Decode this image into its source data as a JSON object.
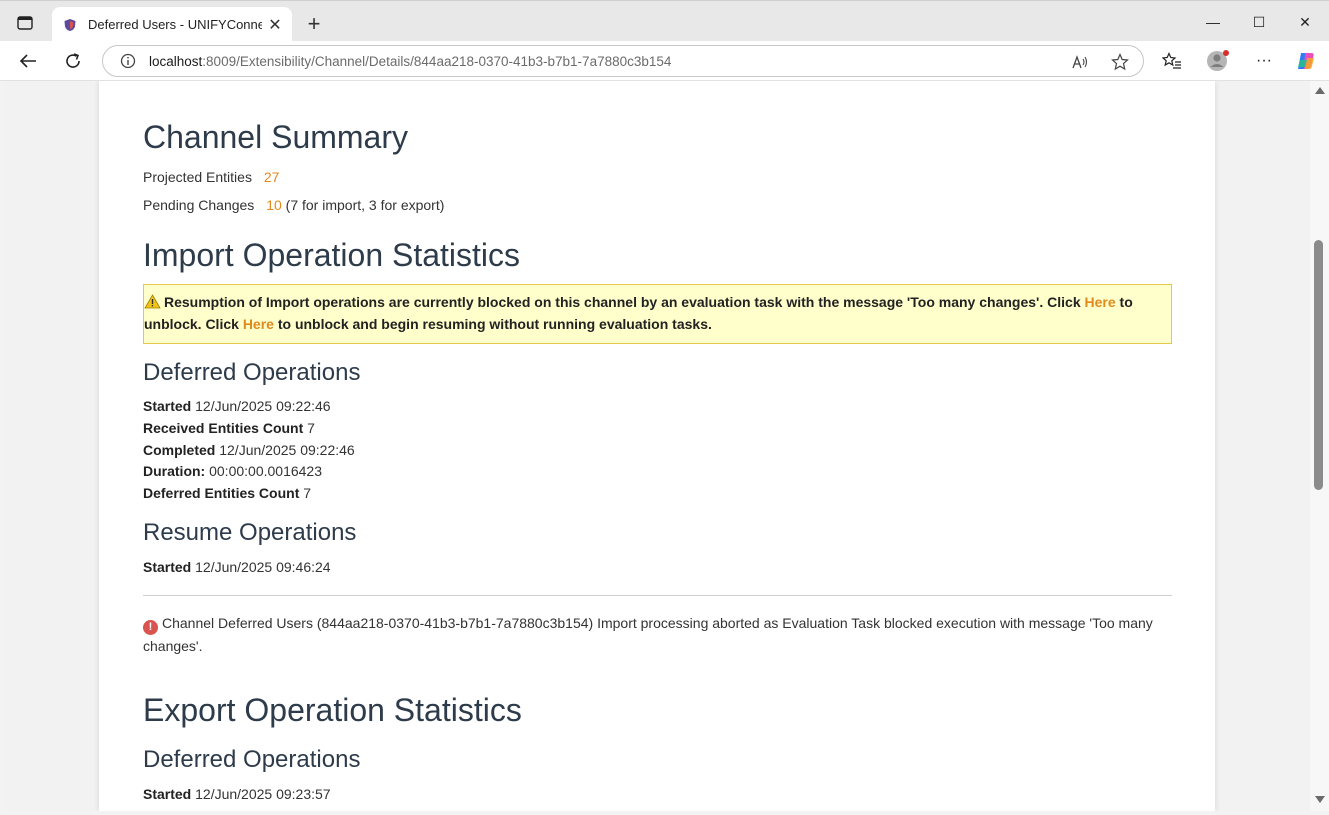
{
  "browser": {
    "tab_title": "Deferred Users - UNIFYConnect",
    "tab_close": "✕",
    "new_tab": "+",
    "url_host": "localhost",
    "url_path": ":8009/Extensibility/Channel/Details/844aa218-0370-41b3-b7b1-7a7880c3b154",
    "minimize": "—",
    "maximize": "☐",
    "close": "✕",
    "more": "···"
  },
  "channel_summary": {
    "title": "Channel Summary",
    "projected_label": "Projected Entities",
    "projected_value": "27",
    "pending_label": "Pending Changes",
    "pending_value": "10",
    "pending_detail": "(7 for import, 3 for export)"
  },
  "import_stats": {
    "title": "Import Operation Statistics",
    "warning": {
      "text1": "Resumption of Import operations are currently blocked on this channel by an evaluation task with the message 'Too many changes'. Click ",
      "link1": "Here",
      "text2": " to unblock. Click ",
      "link2": "Here",
      "text3": " to unblock and begin resuming without running evaluation tasks."
    },
    "deferred": {
      "title": "Deferred Operations",
      "started_label": "Started",
      "started_value": "12/Jun/2025 09:22:46",
      "received_label": "Received Entities Count",
      "received_value": "7",
      "completed_label": "Completed",
      "completed_value": "12/Jun/2025 09:22:46",
      "duration_label": "Duration:",
      "duration_value": "00:00:00.0016423",
      "deferred_count_label": "Deferred Entities Count",
      "deferred_count_value": "7"
    },
    "resume": {
      "title": "Resume Operations",
      "started_label": "Started",
      "started_value": "12/Jun/2025 09:46:24"
    },
    "error_message": "Channel Deferred Users (844aa218-0370-41b3-b7b1-7a7880c3b154) Import processing aborted as Evaluation Task blocked execution with message 'Too many changes'."
  },
  "export_stats": {
    "title": "Export Operation Statistics",
    "deferred": {
      "title": "Deferred Operations",
      "started_label": "Started",
      "started_value": "12/Jun/2025 09:23:57"
    }
  },
  "colors": {
    "accent": "#e08a1e",
    "heading": "#2d3b4a",
    "warning_bg": "#ffffcc",
    "error": "#d9534f"
  }
}
